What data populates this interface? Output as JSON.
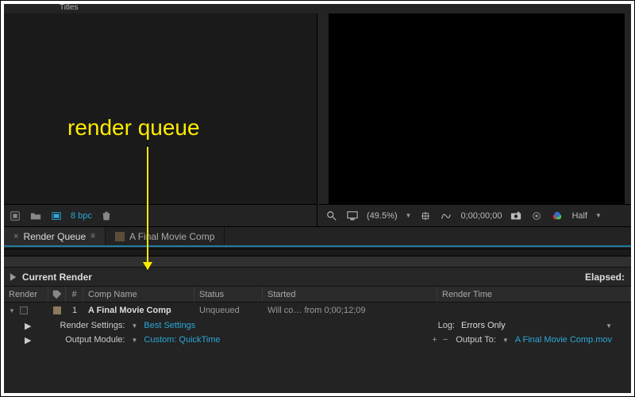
{
  "annotation": {
    "label": "render queue"
  },
  "project_panel": {
    "top_item": "Titles"
  },
  "project_footer": {
    "bpc_label": "8 bpc"
  },
  "viewer_footer": {
    "zoom": "(49.5%)",
    "timecode": "0;00;00;00",
    "resolution": "Half"
  },
  "tabs": {
    "active": {
      "label": "Render Queue"
    },
    "other": {
      "label": "A Final Movie Comp"
    }
  },
  "render_queue": {
    "current_render_label": "Current Render",
    "elapsed_label": "Elapsed:",
    "columns": {
      "render": "Render",
      "tag": "",
      "num": "#",
      "comp_name": "Comp Name",
      "status": "Status",
      "started": "Started",
      "render_time": "Render Time"
    },
    "items": [
      {
        "num": "1",
        "comp_name": "A Final Movie Comp",
        "status": "Unqueued",
        "started": "Will co… from 0;00;12;09",
        "render_time": "",
        "render_settings": {
          "label": "Render Settings:",
          "value": "Best Settings"
        },
        "output_module": {
          "label": "Output Module:",
          "value": "Custom: QuickTime"
        },
        "log": {
          "label": "Log:",
          "value": "Errors Only"
        },
        "output_to": {
          "label": "Output To:",
          "value": "A Final Movie Comp.mov"
        }
      }
    ]
  }
}
